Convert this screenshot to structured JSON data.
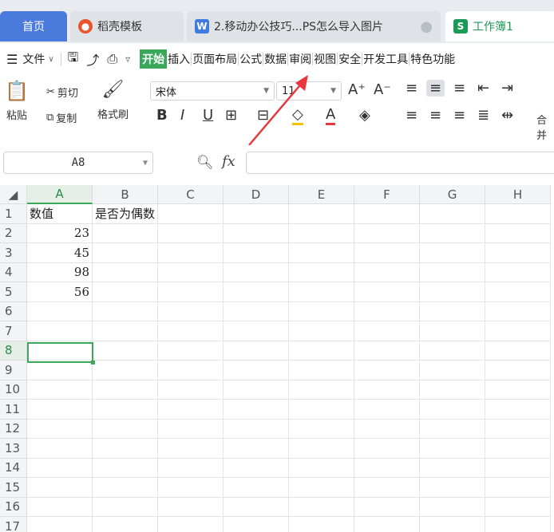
{
  "tabs": [
    {
      "label": "首页"
    },
    {
      "label": "稻壳模板"
    },
    {
      "label": "2.移动办公技巧...PS怎么导入图片"
    },
    {
      "label": "工作簿1"
    }
  ],
  "menu": {
    "file": "文件",
    "items": [
      "开始",
      "插入",
      "页面布局",
      "公式",
      "数据",
      "审阅",
      "视图",
      "安全",
      "开发工具",
      "特色功能"
    ]
  },
  "ribbon": {
    "cut": "剪切",
    "copy": "复制",
    "paste": "粘贴",
    "format_painter": "格式刷",
    "font_name": "宋体",
    "font_size": "11",
    "merge": "合并"
  },
  "formula_bar": {
    "cell_ref": "A8",
    "fx": "fx",
    "value": ""
  },
  "columns": [
    "A",
    "B",
    "C",
    "D",
    "E",
    "F",
    "G",
    "H"
  ],
  "rows": [
    "1",
    "2",
    "3",
    "4",
    "5",
    "6",
    "7",
    "8",
    "9",
    "10",
    "11",
    "12",
    "13",
    "14",
    "15",
    "16",
    "17"
  ],
  "cells": {
    "A1": "数值",
    "B1": "是否为偶数",
    "A2": "23",
    "A3": "45",
    "A4": "98",
    "A5": "56"
  },
  "colors": {
    "accent": "#3aa85b",
    "home_tab": "#4a7bdc",
    "arrow": "#e8383d"
  }
}
